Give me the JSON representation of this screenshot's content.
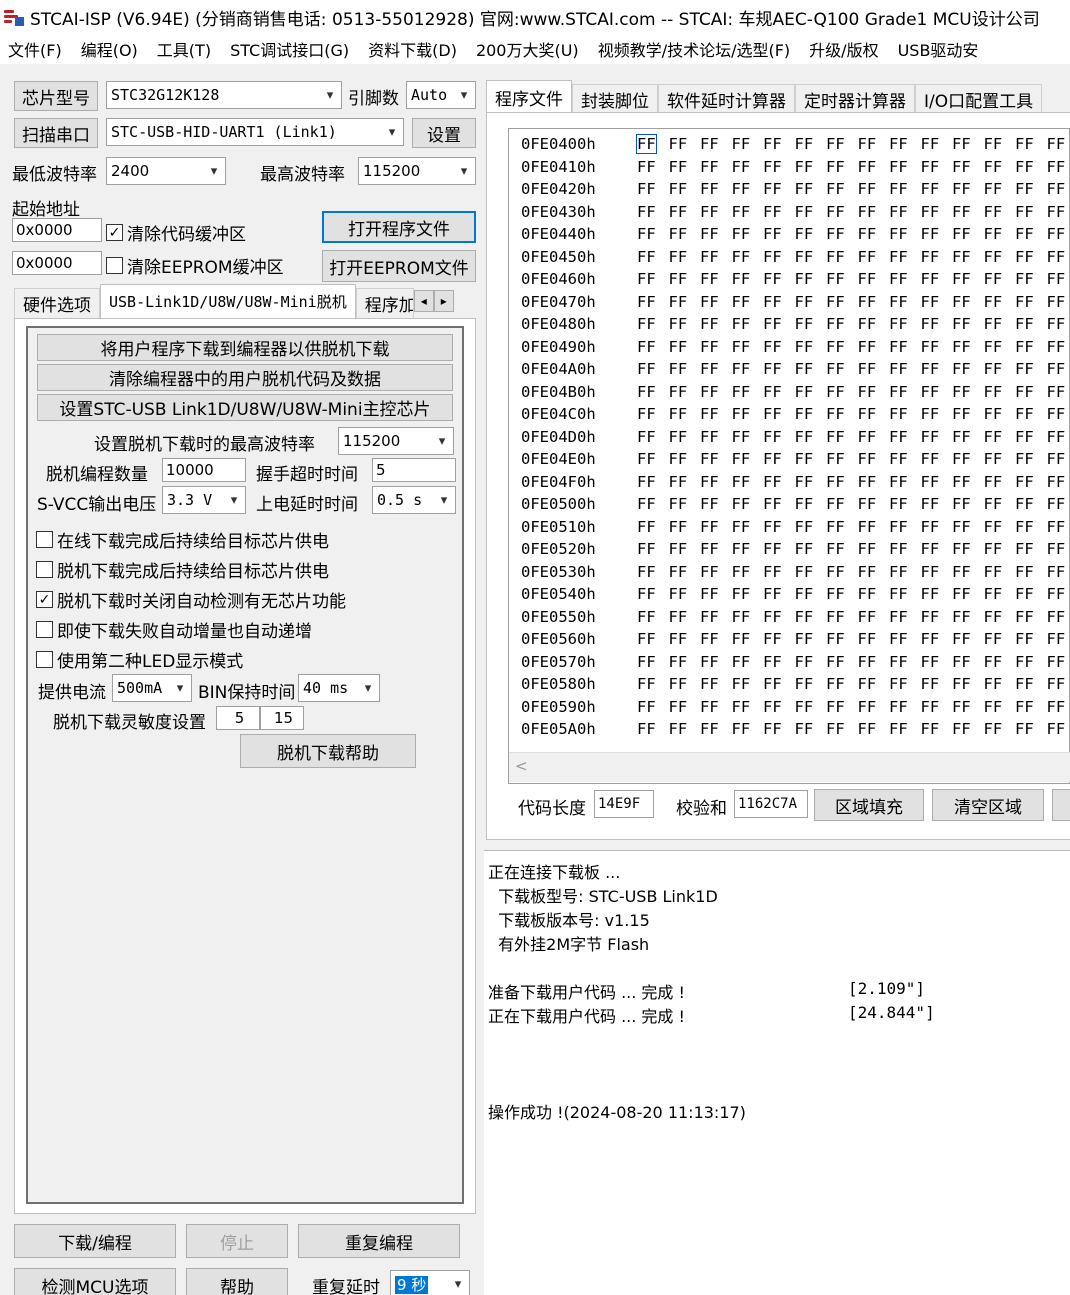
{
  "title_bar": {
    "title": "STCAI-ISP (V6.94E) (分销商销售电话: 0513-55012928) 官网:www.STCAI.com  -- STCAI: 车规AEC-Q100 Grade1 MCU设计公司"
  },
  "menu": [
    "文件(F)",
    "编程(O)",
    "工具(T)",
    "STC调试接口(G)",
    "资料下载(D)",
    "200万大奖(U)",
    "视频教学/技术论坛/选型(F)",
    "升级/版权",
    "USB驱动安"
  ],
  "left": {
    "chip_label": "芯片型号",
    "chip_value": "STC32G12K128",
    "pin_label": "引脚数",
    "pin_value": "Auto",
    "scan_button": "扫描串口",
    "port_value": "STC-USB-HID-UART1 (Link1)",
    "settings_button": "设置",
    "min_baud_label": "最低波特率",
    "min_baud_value": "2400",
    "max_baud_label": "最高波特率",
    "max_baud_value": "115200",
    "start_addr_label": "起始地址",
    "code_addr": "0x0000",
    "clear_code_label": "清除代码缓冲区",
    "open_program_button": "打开程序文件",
    "eeprom_addr": "0x0000",
    "clear_eeprom_label": "清除EEPROM缓冲区",
    "open_eeprom_button": "打开EEPROM文件",
    "tabs": [
      "硬件选项",
      "USB-Link1D/U8W/U8W-Mini脱机",
      "程序加"
    ],
    "scroll_left": "◂",
    "scroll_right": "▸"
  },
  "offline": {
    "btn_download": "将用户程序下载到编程器以供脱机下载",
    "btn_clear": "清除编程器中的用户脱机代码及数据",
    "btn_setup": "设置STC-USB Link1D/U8W/U8W-Mini主控芯片",
    "max_baud_label": "设置脱机下载时的最高波特率",
    "max_baud_value": "115200",
    "count_label": "脱机编程数量",
    "count_value": "10000",
    "handshake_label": "握手超时时间",
    "handshake_value": "5",
    "svcc_label": "S-VCC输出电压",
    "svcc_value": "3.3 V",
    "power_delay_label": "上电延时时间",
    "power_delay_value": "0.5 s",
    "options": [
      {
        "label": "在线下载完成后持续给目标芯片供电",
        "checked": false
      },
      {
        "label": "脱机下载完成后持续给目标芯片供电",
        "checked": false
      },
      {
        "label": "脱机下载时关闭自动检测有无芯片功能",
        "checked": true
      },
      {
        "label": "即使下载失败自动增量也自动递增",
        "checked": false
      },
      {
        "label": "使用第二种LED显示模式",
        "checked": false
      }
    ],
    "current_label": "提供电流",
    "current_value": "500mA",
    "bin_hold_label": "BIN保持时间",
    "bin_hold_value": "40 ms",
    "sensitivity_label": "脱机下载灵敏度设置",
    "sens1": "5",
    "sens2": "15",
    "help_button": "脱机下载帮助"
  },
  "bottom": {
    "download": "下载/编程",
    "stop": "停止",
    "repeat": "重复编程",
    "check_mcu": "检测MCU选项",
    "help": "帮助",
    "repeat_delay_label": "重复延时",
    "repeat_delay_value": "9 秒"
  },
  "right_tabs": [
    "程序文件",
    "封装脚位",
    "软件延时计算器",
    "定时器计算器",
    "I/O口配置工具"
  ],
  "hex": {
    "addresses": [
      "0FE0400h",
      "0FE0410h",
      "0FE0420h",
      "0FE0430h",
      "0FE0440h",
      "0FE0450h",
      "0FE0460h",
      "0FE0470h",
      "0FE0480h",
      "0FE0490h",
      "0FE04A0h",
      "0FE04B0h",
      "0FE04C0h",
      "0FE04D0h",
      "0FE04E0h",
      "0FE04F0h",
      "0FE0500h",
      "0FE0510h",
      "0FE0520h",
      "0FE0530h",
      "0FE0540h",
      "0FE0550h",
      "0FE0560h",
      "0FE0570h",
      "0FE0580h",
      "0FE0590h",
      "0FE05A0h"
    ],
    "byte": "FF",
    "bytes_per_row": 14,
    "scroll_glyph": "<"
  },
  "code_info": {
    "length_label": "代码长度",
    "length_value": "14E9F",
    "checksum_label": "校验和",
    "checksum_value": "1162C7A",
    "fill_button": "区域填充",
    "clear_button": "清空区域"
  },
  "log": {
    "lines": [
      "正在连接下载板 ...",
      "  下载板型号: STC-USB Link1D",
      "  下载板版本号: v1.15",
      "  有外挂2M字节 Flash",
      "",
      "准备下载用户代码 ... 完成 !",
      "正在下载用户代码 ... 完成 !",
      "",
      "",
      "",
      "操作成功 !(2024-08-20 11:13:17)"
    ],
    "timing1": "[2.109\"]",
    "timing2": "[24.844\"]"
  }
}
